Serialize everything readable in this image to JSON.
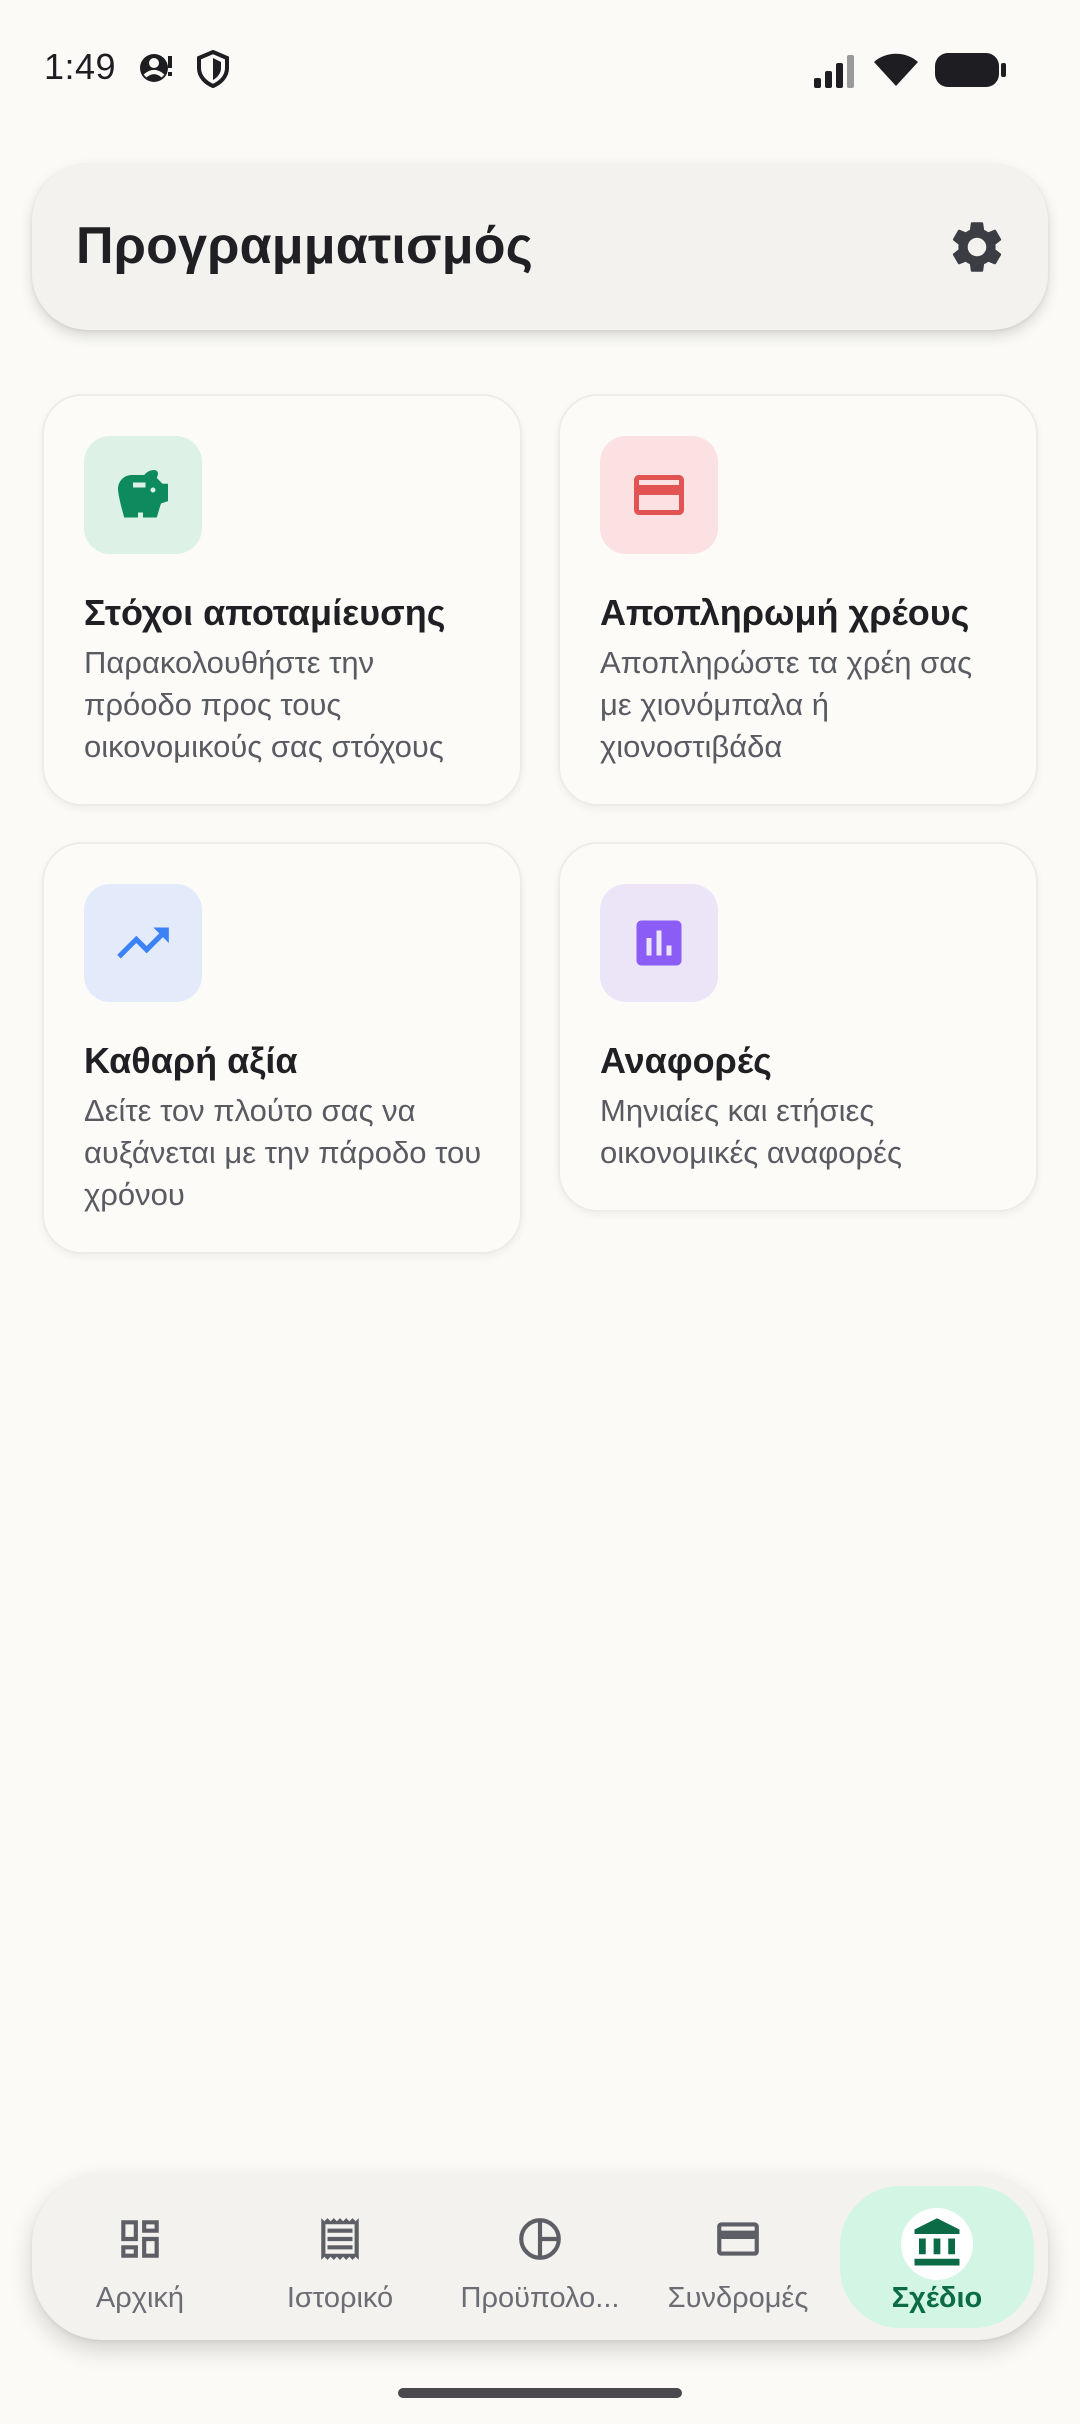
{
  "status_bar": {
    "time": "1:49"
  },
  "header": {
    "title": "Προγραμματισμός",
    "settings_icon": "gear-icon"
  },
  "colors": {
    "accent_green": "#0E8A5F",
    "accent_red": "#E25353",
    "accent_blue": "#3B82F6",
    "accent_purple": "#8B5CF6",
    "active_nav_bg": "#D3F5E4"
  },
  "cards": [
    {
      "title": "Στόχοι αποταμίευσης",
      "description": "Παρακολουθήστε την πρόοδο προς τους οικονομικούς σας στόχους",
      "icon": "piggy-bank-icon"
    },
    {
      "title": "Αποπληρωμή χρέους",
      "description": "Αποπληρώστε τα χρέη σας με χιονόμπαλα ή χιονοστιβάδα",
      "icon": "credit-card-icon"
    },
    {
      "title": "Καθαρή αξία",
      "description": "Δείτε τον πλούτο σας να αυξάνεται με την πάροδο του χρόνου",
      "icon": "trending-up-icon"
    },
    {
      "title": "Αναφορές",
      "description": "Μηνιαίες και ετήσιες οικονομικές αναφορές",
      "icon": "bar-chart-icon"
    }
  ],
  "nav": {
    "items": [
      {
        "label": "Αρχική",
        "icon": "dashboard-icon"
      },
      {
        "label": "Ιστορικό",
        "icon": "receipt-icon"
      },
      {
        "label": "Προϋπολο...",
        "icon": "pie-chart-icon"
      },
      {
        "label": "Συνδρομές",
        "icon": "credit-card-icon"
      },
      {
        "label": "Σχέδιο",
        "icon": "bank-icon",
        "active": true
      }
    ]
  }
}
